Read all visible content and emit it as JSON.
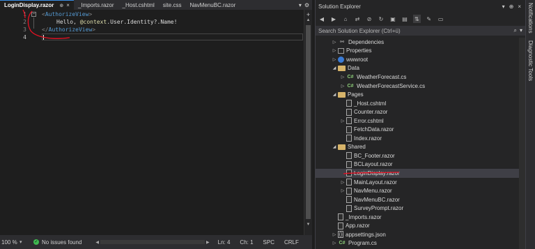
{
  "editor": {
    "tabs": [
      {
        "label": "LoginDisplay.razor",
        "active": true
      },
      {
        "label": "_Imports.razor",
        "active": false
      },
      {
        "label": "_Host.cshtml",
        "active": false
      },
      {
        "label": "site.css",
        "active": false
      },
      {
        "label": "NavMenuBC.razor",
        "active": false
      }
    ],
    "line_numbers": [
      "1",
      "2",
      "3",
      "4"
    ],
    "code": {
      "line1_open_bracket": "<",
      "line1_tag": "AuthorizeView",
      "line1_close_bracket": ">",
      "line2_text": "Hello, ",
      "line2_razor": "@context",
      "line2_rest": ".User.Identity?.Name!",
      "line3_open_bracket": "</",
      "line3_tag": "AuthorizeView",
      "line3_close_bracket": ">"
    },
    "status": {
      "zoom": "100 %",
      "issues": "No issues found",
      "line": "Ln: 4",
      "col": "Ch: 1",
      "spc": "SPC",
      "eol": "CRLF"
    }
  },
  "solution_explorer": {
    "title": "Solution Explorer",
    "search_placeholder": "Search Solution Explorer (Ctrl+ü)",
    "items": [
      {
        "label": "Dependencies",
        "indent": 1,
        "arrow": "closed",
        "icon": "dependencies-icon"
      },
      {
        "label": "Properties",
        "indent": 1,
        "arrow": "closed",
        "icon": "properties-icon"
      },
      {
        "label": "wwwroot",
        "indent": 1,
        "arrow": "closed",
        "icon": "globe-icon"
      },
      {
        "label": "Data",
        "indent": 1,
        "arrow": "open",
        "icon": "folder-icon"
      },
      {
        "label": "WeatherForecast.cs",
        "indent": 2,
        "arrow": "closed",
        "icon": "csharp-file-icon"
      },
      {
        "label": "WeatherForecastService.cs",
        "indent": 2,
        "arrow": "closed",
        "icon": "csharp-file-icon"
      },
      {
        "label": "Pages",
        "indent": 1,
        "arrow": "open",
        "icon": "folder-icon"
      },
      {
        "label": "_Host.cshtml",
        "indent": 2,
        "arrow": "none",
        "icon": "file-icon"
      },
      {
        "label": "Counter.razor",
        "indent": 2,
        "arrow": "none",
        "icon": "file-icon"
      },
      {
        "label": "Error.cshtml",
        "indent": 2,
        "arrow": "closed",
        "icon": "file-icon"
      },
      {
        "label": "FetchData.razor",
        "indent": 2,
        "arrow": "none",
        "icon": "file-icon"
      },
      {
        "label": "Index.razor",
        "indent": 2,
        "arrow": "none",
        "icon": "file-icon"
      },
      {
        "label": "Shared",
        "indent": 1,
        "arrow": "open",
        "icon": "folder-icon"
      },
      {
        "label": "BC_Footer.razor",
        "indent": 2,
        "arrow": "none",
        "icon": "file-icon"
      },
      {
        "label": "BCLayout.razor",
        "indent": 2,
        "arrow": "none",
        "icon": "file-icon"
      },
      {
        "label": "LoginDisplay.razor",
        "indent": 2,
        "arrow": "none",
        "icon": "file-icon",
        "selected": true
      },
      {
        "label": "MainLayout.razor",
        "indent": 2,
        "arrow": "closed",
        "icon": "file-icon"
      },
      {
        "label": "NavMenu.razor",
        "indent": 2,
        "arrow": "closed",
        "icon": "file-icon"
      },
      {
        "label": "NavMenuBC.razor",
        "indent": 2,
        "arrow": "none",
        "icon": "file-icon"
      },
      {
        "label": "SurveyPrompt.razor",
        "indent": 2,
        "arrow": "none",
        "icon": "file-icon"
      },
      {
        "label": "_Imports.razor",
        "indent": 1,
        "arrow": "none",
        "icon": "file-icon"
      },
      {
        "label": "App.razor",
        "indent": 1,
        "arrow": "none",
        "icon": "file-icon"
      },
      {
        "label": "appsettings.json",
        "indent": 1,
        "arrow": "closed",
        "icon": "json-file-icon"
      },
      {
        "label": "Program.cs",
        "indent": 1,
        "arrow": "closed",
        "icon": "csharp-file-icon"
      }
    ]
  },
  "side_rail": {
    "notifications": "Notifications",
    "diagnostic_tools": "Diagnostic Tools"
  },
  "colors": {
    "accent": "#3a8ee6",
    "annotation_red": "#e81123",
    "ok_green": "#3fb950"
  }
}
